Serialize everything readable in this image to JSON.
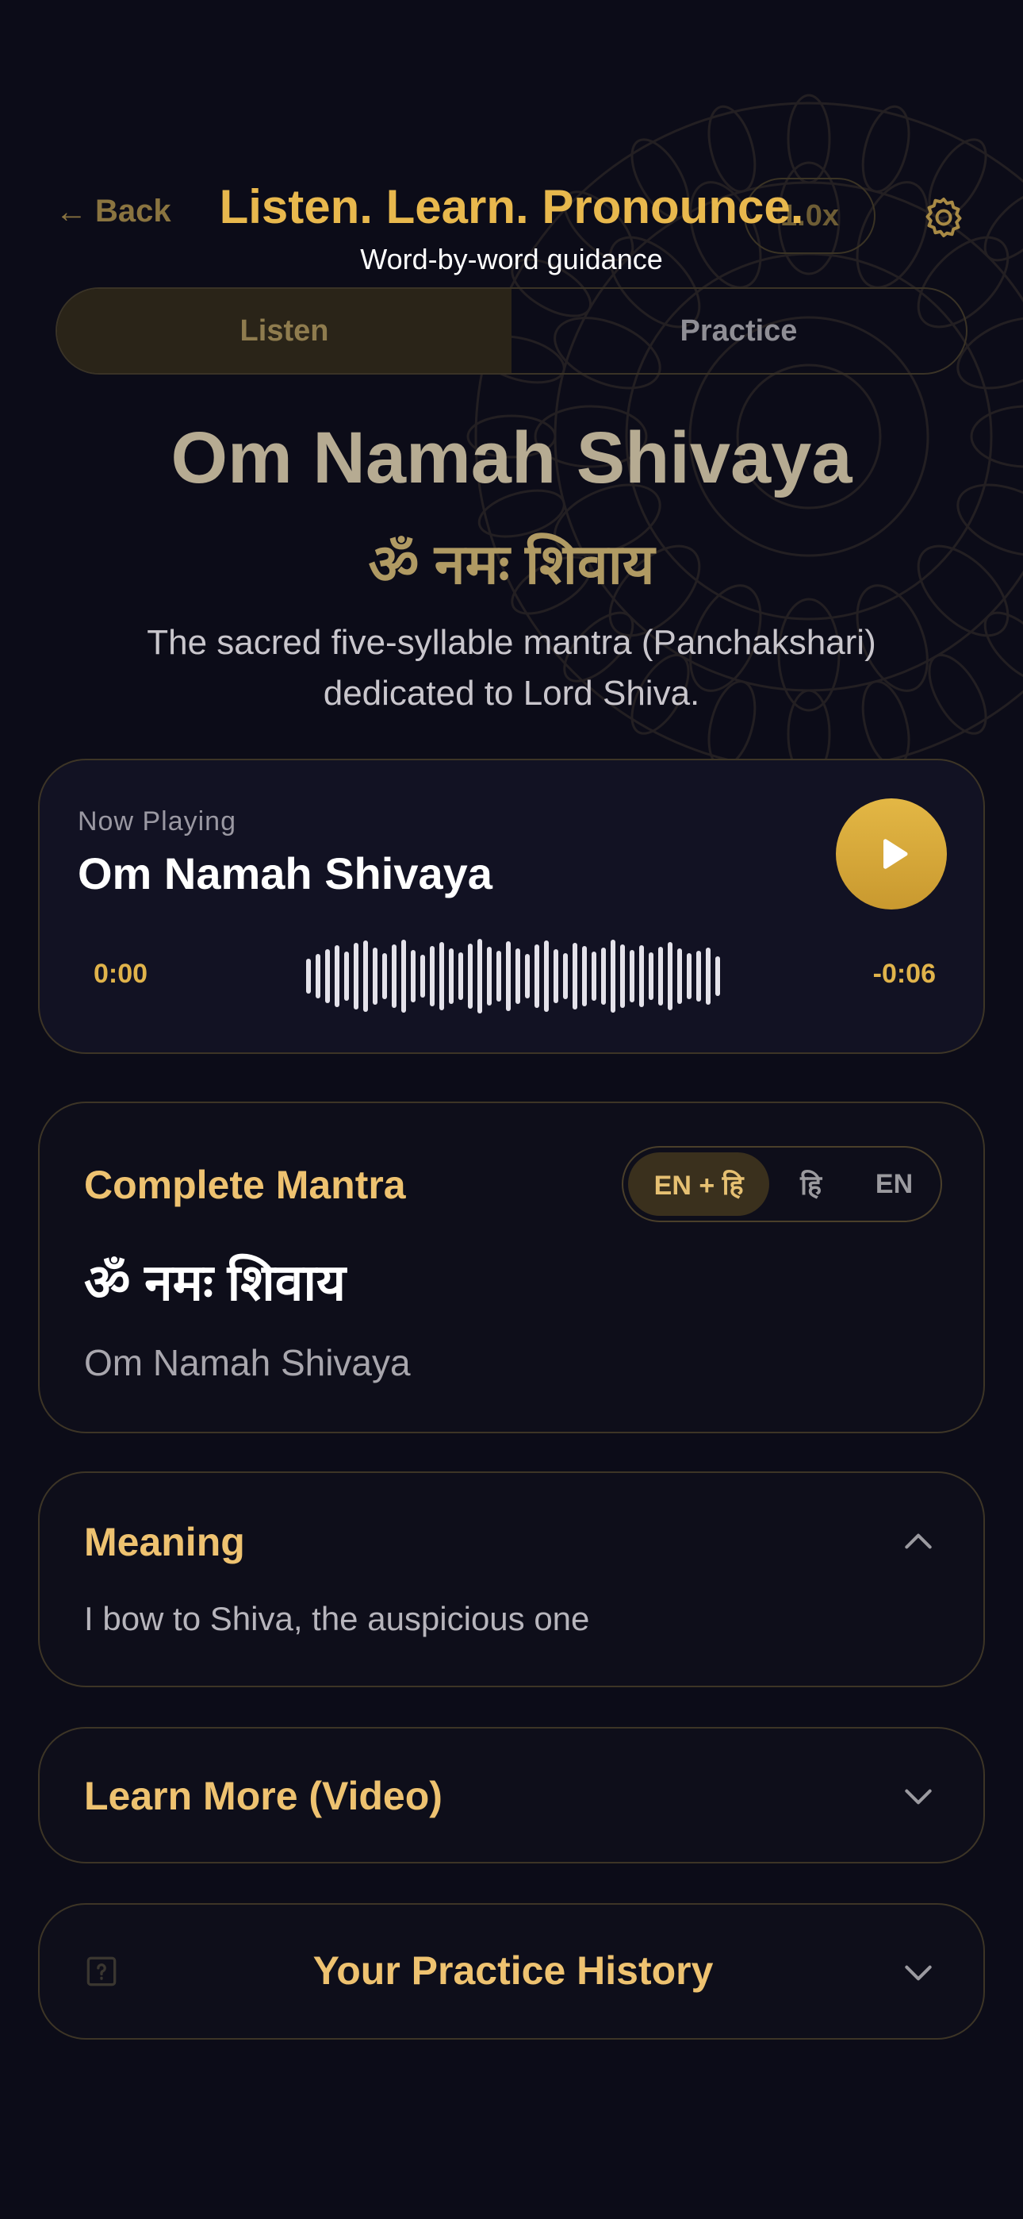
{
  "header": {
    "back_label": "Back",
    "title": "Listen. Learn. Pronounce.",
    "subtitle": "Word-by-word guidance",
    "speed_label": "1.0x"
  },
  "tabs": [
    {
      "label": "Listen",
      "active": true
    },
    {
      "label": "Practice",
      "active": false
    }
  ],
  "mantra": {
    "title": "Om Namah Shivaya",
    "devanagari": "ॐ नमः शिवाय",
    "description": "The sacred five-syllable mantra (Panchakshari) dedicated to Lord Shiva."
  },
  "player": {
    "now_playing_label": "Now Playing",
    "track_title": "Om Namah Shivaya",
    "time_elapsed": "0:00",
    "time_remaining": "-0:06",
    "playing": false
  },
  "complete_mantra": {
    "heading": "Complete Mantra",
    "language_options": [
      "EN + हि",
      "हि",
      "EN"
    ],
    "selected_language": "EN + हि",
    "devanagari": "ॐ नमः शिवाय",
    "transliteration": "Om Namah Shivaya"
  },
  "meaning": {
    "heading": "Meaning",
    "text": "I bow to Shiva, the auspicious one",
    "expanded": true
  },
  "video": {
    "heading": "Learn More (Video)",
    "expanded": false
  },
  "history": {
    "heading": "Your Practice History",
    "expanded": false
  },
  "colors": {
    "background": "#0c0c18",
    "accent_gold": "#e8b84d",
    "card_border": "#3d3526"
  },
  "icons": {
    "back": "arrow-left-icon",
    "settings": "gear-icon",
    "play": "play-icon",
    "collapse": "chevron-up-icon",
    "expand": "chevron-down-icon",
    "help": "help-icon"
  }
}
